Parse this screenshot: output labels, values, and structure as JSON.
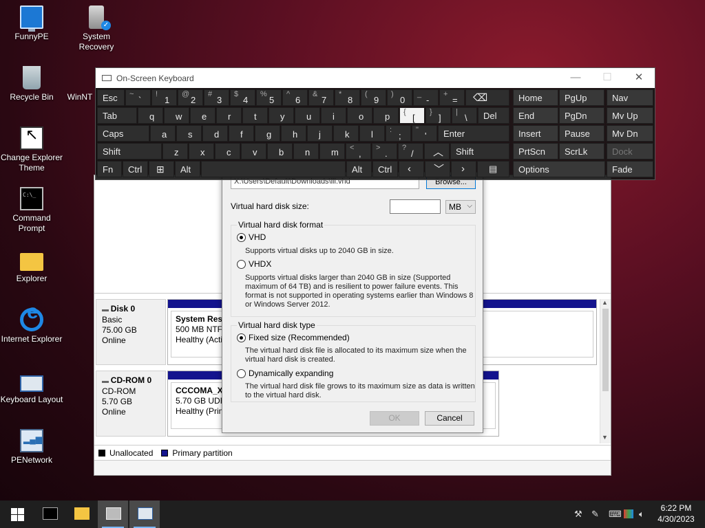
{
  "desktop_icons": [
    {
      "label": "FunnyPE"
    },
    {
      "label": "System Recovery"
    },
    {
      "label": "Recycle Bin"
    },
    {
      "label": "WinNT"
    },
    {
      "label": "Change Explorer Theme"
    },
    {
      "label": "Command Prompt"
    },
    {
      "label": "Explorer"
    },
    {
      "label": "Internet Explorer"
    },
    {
      "label": "Keyboard Layout"
    },
    {
      "label": "PENetwork"
    }
  ],
  "disk_management": {
    "disks": [
      {
        "name": "Disk 0",
        "type": "Basic",
        "size": "75.00 GB",
        "status": "Online",
        "partition": {
          "name": "System Rese",
          "detail": "500 MB NTFS",
          "health": "Healthy (Activ"
        }
      },
      {
        "name": "CD-ROM 0",
        "type": "CD-ROM",
        "size": "5.70 GB",
        "status": "Online",
        "partition": {
          "name": "CCCOMA_X64",
          "detail": "5.70 GB UDF",
          "health": "Healthy (Prim"
        }
      }
    ],
    "legend": [
      {
        "label": "Unallocated",
        "color": "#000000"
      },
      {
        "label": "Primary partition",
        "color": "#14148e"
      }
    ]
  },
  "dialog": {
    "path_value": "X:\\Users\\Default\\Downloads\\lll.vhd",
    "browse_label": "Browse...",
    "size_label": "Virtual hard disk size:",
    "size_value": "",
    "size_unit": "MB",
    "format_group": {
      "title": "Virtual hard disk format",
      "options": [
        {
          "label": "VHD",
          "selected": true,
          "description": "Supports virtual disks up to 2040 GB in size."
        },
        {
          "label": "VHDX",
          "selected": false,
          "description": "Supports virtual disks larger than 2040 GB in size (Supported maximum of 64 TB) and is resilient to power failure events. This format is not supported in operating systems earlier than Windows 8 or Windows Server 2012."
        }
      ]
    },
    "type_group": {
      "title": "Virtual hard disk type",
      "options": [
        {
          "label": "Fixed size (Recommended)",
          "selected": true,
          "description": "The virtual hard disk file is allocated to its maximum size when the virtual hard disk is created."
        },
        {
          "label": "Dynamically expanding",
          "selected": false,
          "description": "The virtual hard disk file grows to its maximum size as data is written to the virtual hard disk."
        }
      ]
    },
    "ok_label": "OK",
    "cancel_label": "Cancel"
  },
  "osk": {
    "title": "On-Screen Keyboard",
    "keys": {
      "esc": "Esc",
      "tab": "Tab",
      "caps": "Caps",
      "shift": "Shift",
      "fn": "Fn",
      "ctrl": "Ctrl",
      "alt": "Alt",
      "del": "Del",
      "enter": "Enter",
      "shift_r": "Shift",
      "alt_r": "Alt",
      "ctrl_r": "Ctrl",
      "home": "Home",
      "pgup": "PgUp",
      "nav": "Nav",
      "end": "End",
      "pgdn": "PgDn",
      "mvup": "Mv Up",
      "insert": "Insert",
      "pause": "Pause",
      "mvdn": "Mv Dn",
      "prtscn": "PrtScn",
      "scrlk": "ScrLk",
      "dock": "Dock",
      "options": "Options",
      "fade": "Fade"
    },
    "num_row": [
      [
        "~",
        "`"
      ],
      [
        "!",
        "1"
      ],
      [
        "@",
        "2"
      ],
      [
        "#",
        "3"
      ],
      [
        "$",
        "4"
      ],
      [
        "%",
        "5"
      ],
      [
        "^",
        "6"
      ],
      [
        "&",
        "7"
      ],
      [
        "*",
        "8"
      ],
      [
        "(",
        "9"
      ],
      [
        ")",
        "0"
      ],
      [
        "_",
        "-"
      ],
      [
        "+",
        "="
      ]
    ],
    "row_q": [
      "q",
      "w",
      "e",
      "r",
      "t",
      "y",
      "u",
      "i",
      "o",
      "p"
    ],
    "row_q_sym": [
      [
        "{",
        "["
      ],
      [
        "}",
        "]"
      ],
      [
        "|",
        "\\"
      ]
    ],
    "row_a": [
      "a",
      "s",
      "d",
      "f",
      "g",
      "h",
      "j",
      "k",
      "l"
    ],
    "row_a_sym": [
      [
        ":",
        ";"
      ],
      [
        "\"",
        "'"
      ]
    ],
    "row_z": [
      "z",
      "x",
      "c",
      "v",
      "b",
      "n",
      "m"
    ],
    "row_z_sym": [
      [
        "<",
        ","
      ],
      [
        ">",
        "."
      ],
      [
        "?",
        "/"
      ]
    ]
  },
  "taskbar": {
    "time": "6:22 PM",
    "date": "4/30/2023"
  }
}
